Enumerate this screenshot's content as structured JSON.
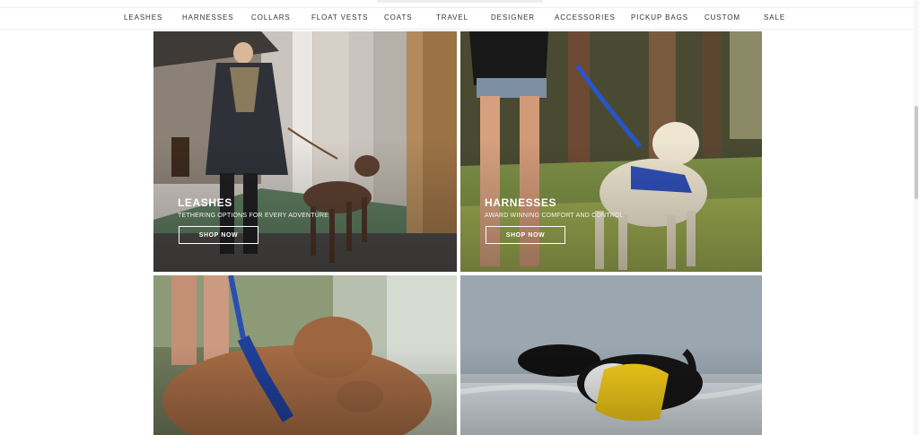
{
  "nav": {
    "items": [
      "LEASHES",
      "HARNESSES",
      "COLLARS",
      "FLOAT VESTS",
      "COATS",
      "TRAVEL",
      "DESIGNER",
      "ACCESSORIES",
      "PICKUP BAGS",
      "CUSTOM",
      "SALE"
    ]
  },
  "tiles": [
    {
      "title": "LEASHES",
      "subtitle": "TETHERING OPTIONS FOR EVERY ADVENTURE",
      "button": "SHOP NOW"
    },
    {
      "title": "HARNESSES",
      "subtitle": "AWARD WINNING COMFORT AND CONTROL",
      "button": "SHOP NOW"
    }
  ],
  "photos": {
    "tile1": "photo of man in suit walking brown pointer dog on leash",
    "tile2": "photo of yellow labrador in blue harness on leash outdoors",
    "tile3": "photo of brown dog wearing blue collar",
    "tile4": "photo of black and white dog in yellow float vest in water"
  },
  "colors": {
    "nav_text": "#333333",
    "border": "#ececec",
    "button_border": "#ffffff"
  }
}
